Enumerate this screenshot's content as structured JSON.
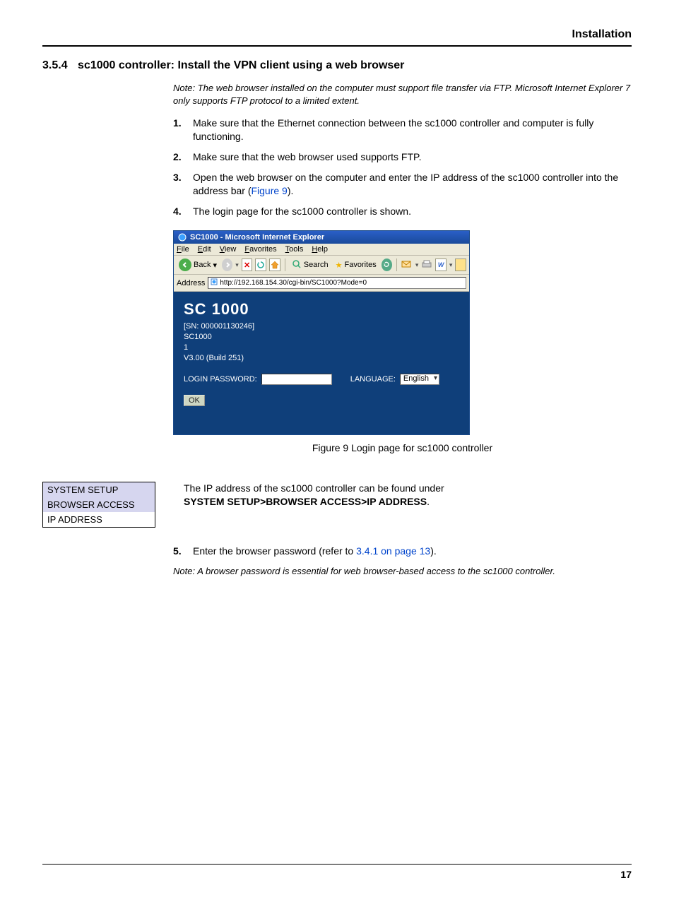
{
  "header": {
    "title": "Installation"
  },
  "section": {
    "number": "3.5.4",
    "title": "sc1000 controller: Install the VPN client using a web browser"
  },
  "note1": "Note: The web browser installed on the computer must support file transfer via FTP. Microsoft Internet Explorer 7 only supports FTP protocol to a limited extent.",
  "steps": {
    "s1": {
      "num": "1.",
      "text": "Make sure that the Ethernet connection between the sc1000 controller and computer is fully functioning."
    },
    "s2": {
      "num": "2.",
      "text": "Make sure that the web browser used supports FTP."
    },
    "s3": {
      "num": "3.",
      "textA": "Open the web browser on the computer and enter the IP address of the sc1000 controller into the address bar (",
      "link": "Figure 9",
      "textB": ")."
    },
    "s4": {
      "num": "4.",
      "text": "The login page for the sc1000 controller is shown."
    },
    "s5": {
      "num": "5.",
      "textA": "Enter the browser password (refer to ",
      "link": "3.4.1 on page 13",
      "textB": ")."
    }
  },
  "ie": {
    "title": "SC1000 - Microsoft Internet Explorer",
    "menus": {
      "file": "File",
      "edit": "Edit",
      "view": "View",
      "favorites": "Favorites",
      "tools": "Tools",
      "help": "Help"
    },
    "toolbar": {
      "back": "Back",
      "search": "Search",
      "favorites": "Favorites"
    },
    "addressLabel": "Address",
    "addressValue": "http://192.168.154.30/cgi-bin/SC1000?Mode=0",
    "content": {
      "title": "SC 1000",
      "sn": "[SN: 000001130246]",
      "name": "SC1000",
      "id": "1",
      "ver": "V3.00 (Build 251)",
      "loginLabel": "LOGIN PASSWORD:",
      "langLabel": "LANGUAGE:",
      "langValue": "English",
      "ok": "OK"
    }
  },
  "figureCaption": "Figure 9 Login page for sc1000 controller",
  "menuBox": {
    "r1": "SYSTEM SETUP",
    "r2": "BROWSER ACCESS",
    "r3": "IP ADDRESS"
  },
  "ipDesc": {
    "line1": "The IP address of the sc1000 controller can be found under",
    "path": "SYSTEM SETUP>BROWSER ACCESS>IP ADDRESS",
    "dot": "."
  },
  "note2": "Note: A browser password is essential for web browser-based access to the sc1000 controller.",
  "pageNumber": "17"
}
